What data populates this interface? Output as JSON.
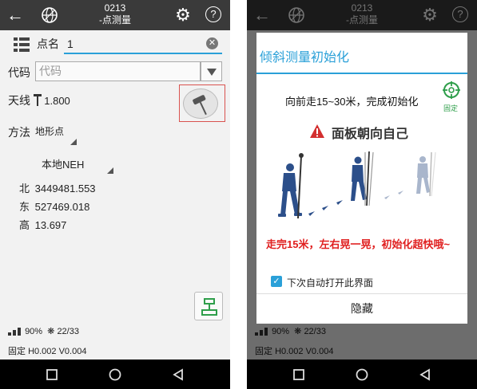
{
  "header": {
    "title_line1": "0213",
    "title_line2": "-点测量"
  },
  "form": {
    "point_name_label": "点名",
    "point_name_value": "1",
    "code_label": "代码",
    "code_placeholder": "代码",
    "antenna_label": "天线",
    "antenna_value": "1.800",
    "method_label": "方法",
    "method_value": "地形点",
    "coord_system": "本地NEH",
    "coords": [
      {
        "key": "北",
        "value": "3449481.553"
      },
      {
        "key": "东",
        "value": "527469.018"
      },
      {
        "key": "高",
        "value": "13.697"
      }
    ]
  },
  "status": {
    "battery": "90%",
    "satellites": "22/33",
    "solution": "固定",
    "precision": "H0.002 V0.004"
  },
  "dialog": {
    "title": "倾斜测量初始化",
    "instruction": "向前走15~30米，完成初始化",
    "fix_label": "固定",
    "warning": "面板朝向自己",
    "tip": "走完15米，左右晃一晃，初始化超快哦~",
    "checkbox_label": "下次自动打开此界面",
    "checkbox_checked": true,
    "hide_button": "隐藏"
  },
  "colors": {
    "appbar": "#3a3a3a",
    "accent": "#2aa0d8",
    "tip_red": "#e02020",
    "warn_red": "#d32f2f",
    "fix_green": "#2e9e4a",
    "highlight_frame": "#d9534f"
  },
  "icons": {
    "back": "arrow-left-icon",
    "globe": "globe-icon",
    "settings": "gear-icon",
    "help": "help-icon",
    "list": "list-icon",
    "clear": "clear-icon",
    "tilt": "tilt-survey-icon",
    "survey": "survey-pole-icon",
    "fix": "target-icon",
    "warning": "warning-icon"
  }
}
